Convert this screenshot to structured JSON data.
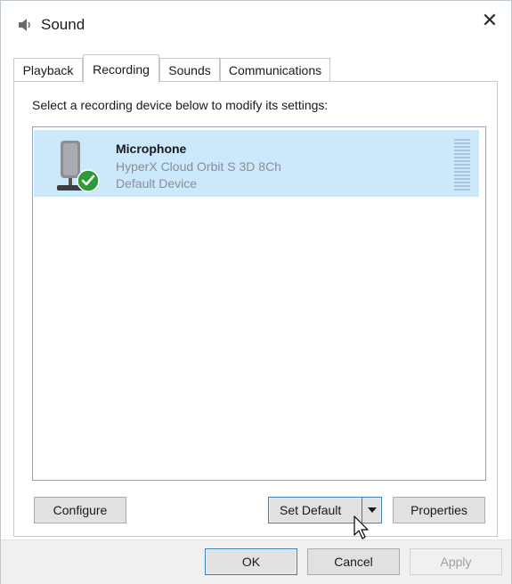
{
  "window": {
    "title": "Sound",
    "close_symbol": "✕"
  },
  "tabs": [
    {
      "label": "Playback",
      "active": false
    },
    {
      "label": "Recording",
      "active": true
    },
    {
      "label": "Sounds",
      "active": false
    },
    {
      "label": "Communications",
      "active": false
    }
  ],
  "panel": {
    "instruction": "Select a recording device below to modify its settings:",
    "devices": [
      {
        "name": "Microphone",
        "description": "HyperX Cloud Orbit S 3D 8Ch",
        "status": "Default Device",
        "selected": true,
        "icon": "microphone-icon",
        "badge": "default-checkmark-icon"
      }
    ],
    "buttons": {
      "configure": "Configure",
      "set_default": "Set Default",
      "properties": "Properties"
    }
  },
  "footer": {
    "ok": "OK",
    "cancel": "Cancel",
    "apply": "Apply"
  },
  "colors": {
    "selection": "#cce8fb",
    "check_badge": "#2e9b3a",
    "focus_border": "#3c7fb1"
  }
}
